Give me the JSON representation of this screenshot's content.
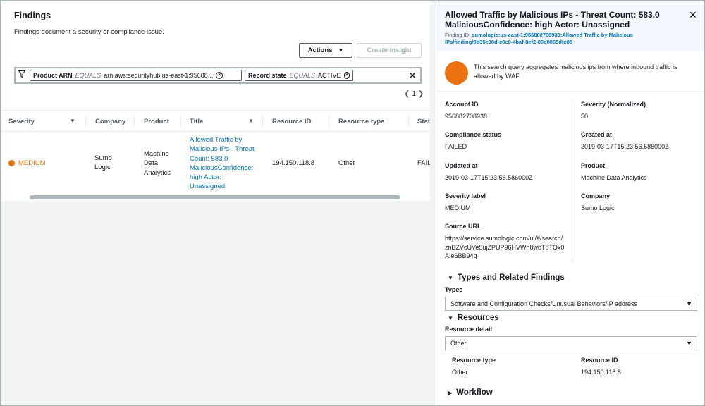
{
  "left": {
    "title": "Findings",
    "subtitle": "Findings document a security or compliance issue.",
    "actions_label": "Actions",
    "create_insight_label": "Create insight",
    "filters": [
      {
        "field": "Product ARN",
        "op": "EQUALS",
        "value": "arn:aws:securityhub:us-east-1:95688..."
      },
      {
        "field": "Record state",
        "op": "EQUALS",
        "value": "ACTIVE"
      }
    ],
    "page_number": "1",
    "columns": [
      "Severity",
      "Company",
      "Product",
      "Title",
      "Resource ID",
      "Resource type",
      "Stat"
    ],
    "row": {
      "severity": "MEDIUM",
      "company": "Sumo Logic",
      "product": "Machine Data Analytics",
      "title": "Allowed Traffic by Malicious IPs - Threat Count: 583.0 MaliciousConfidence: high Actor: Unassigned",
      "resource_id": "194.150.118.8",
      "resource_type": "Other",
      "status": "FAILE"
    }
  },
  "detail": {
    "title": "Allowed Traffic by Malicious IPs - Threat Count: 583.0 MaliciousConfidence: high Actor: Unassigned",
    "finding_id_label": "Finding ID:",
    "finding_id": "sumologic:us-east-1:956882708938:Allowed Traffic by Malicious IPs/finding/9b35e38d-e8c0-4baf-8ef2-80d8065dfc85",
    "description": "This search query aggregates malicious ips from where inbound traffic is allowed by WAF",
    "fields": {
      "account_id": {
        "label": "Account ID",
        "value": "956882708938"
      },
      "severity_normalized": {
        "label": "Severity (Normalized)",
        "value": "50"
      },
      "compliance_status": {
        "label": "Compliance status",
        "value": "FAILED"
      },
      "created_at": {
        "label": "Created at",
        "value": "2019-03-17T15:23:56.586000Z"
      },
      "updated_at": {
        "label": "Updated at",
        "value": "2019-03-17T15:23:56.586000Z"
      },
      "product": {
        "label": "Product",
        "value": "Machine Data Analytics"
      },
      "severity_label": {
        "label": "Severity label",
        "value": "MEDIUM"
      },
      "company": {
        "label": "Company",
        "value": "Sumo Logic"
      },
      "source_url": {
        "label": "Source URL",
        "value": "https://service.sumologic.com/ui/#/search/znBZVcUVe5ujZPUP96HVWh8wbT8TOx0AIe6BB94q"
      }
    },
    "types_section": "Types and Related Findings",
    "types_label": "Types",
    "types_value": "Software and Configuration Checks/Unusual Behaviors/IP address",
    "resources_section": "Resources",
    "resource_detail_label": "Resource detail",
    "resource_detail_value": "Other",
    "resource_type": {
      "label": "Resource type",
      "value": "Other"
    },
    "resource_id": {
      "label": "Resource ID",
      "value": "194.150.118.8"
    },
    "workflow_section": "Workflow"
  },
  "colors": {
    "accent_orange": "#ec7211",
    "link_blue": "#0073bb",
    "header_bg": "#f2f8fd"
  }
}
